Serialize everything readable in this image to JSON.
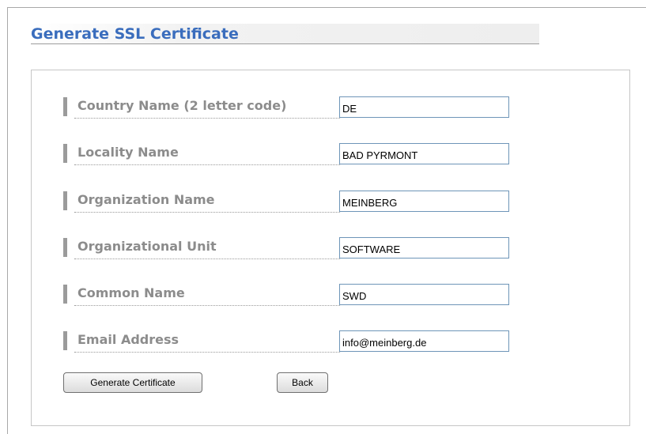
{
  "page": {
    "title": "Generate SSL Certificate",
    "accent_color": "#3a6dbd"
  },
  "form": {
    "fields": [
      {
        "label": "Country Name (2 letter code)",
        "value": "DE"
      },
      {
        "label": "Locality Name",
        "value": "BAD PYRMONT"
      },
      {
        "label": "Organization Name",
        "value": "MEINBERG"
      },
      {
        "label": "Organizational Unit",
        "value": "SOFTWARE"
      },
      {
        "label": "Common Name",
        "value": "SWD"
      },
      {
        "label": "Email Address",
        "value": "info@meinberg.de"
      }
    ]
  },
  "buttons": {
    "generate_label": "Generate Certificate",
    "back_label": "Back"
  }
}
